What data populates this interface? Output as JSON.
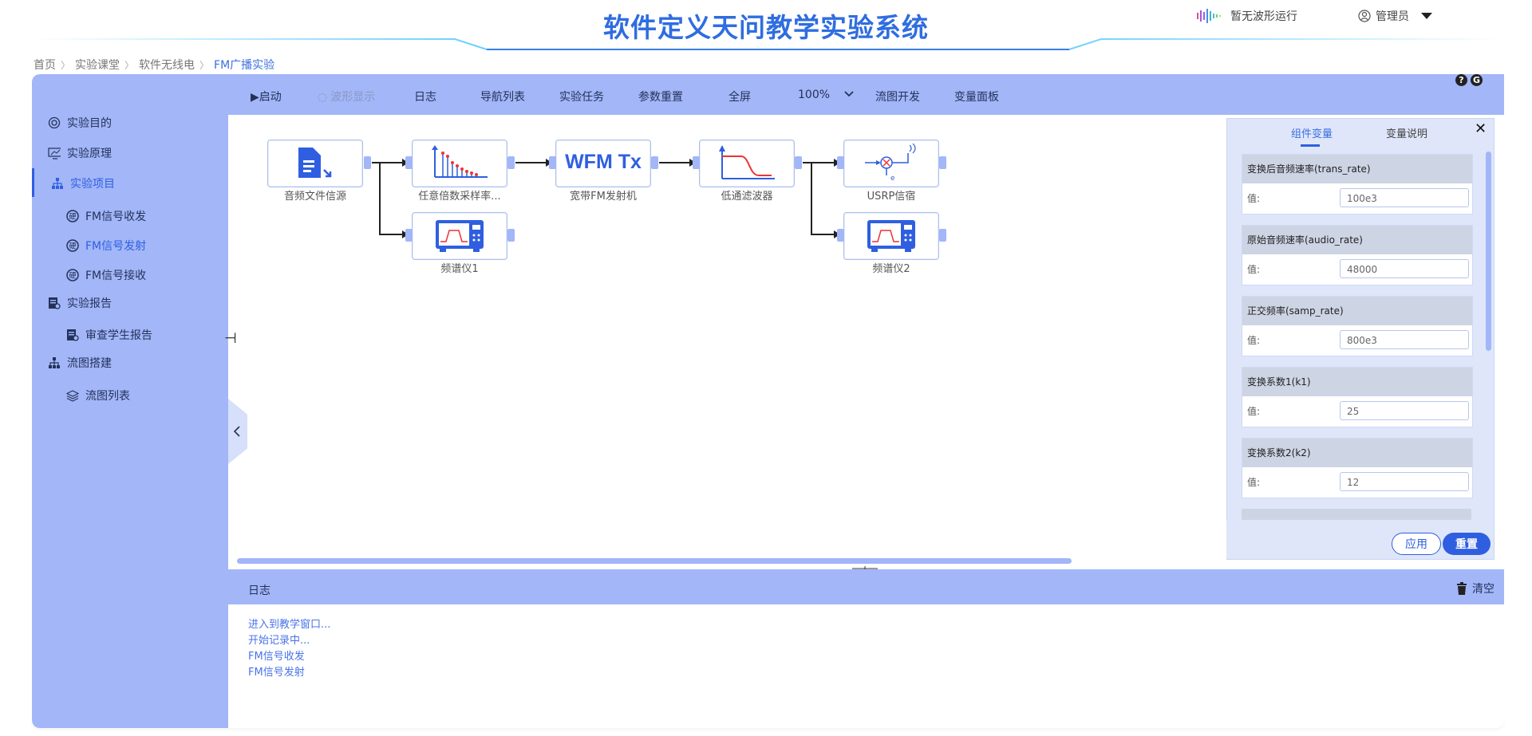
{
  "header": {
    "title": "软件定义天问教学实验系统",
    "wave_status": "暂无波形运行",
    "user": "管理员"
  },
  "breadcrumb": [
    "首页",
    "实验课堂",
    "软件无线电",
    "FM广播实验"
  ],
  "sidebar": {
    "items": [
      {
        "label": "实验目的"
      },
      {
        "label": "实验原理"
      },
      {
        "label": "实验项目"
      },
      {
        "label": "FM信号收发"
      },
      {
        "label": "FM信号发射"
      },
      {
        "label": "FM信号接收"
      },
      {
        "label": "实验报告"
      },
      {
        "label": "审查学生报告"
      },
      {
        "label": "流图搭建"
      },
      {
        "label": "流图列表"
      }
    ]
  },
  "toolbar": {
    "start": "▶启动",
    "waveform": "波形显示",
    "log": "日志",
    "nav_list": "导航列表",
    "task": "实验任务",
    "reset_params": "参数重置",
    "fullscreen": "全屏",
    "zoom": "100%",
    "flow_dev": "流图开发",
    "var_panel": "变量面板"
  },
  "blocks": [
    {
      "label": "音频文件信源",
      "icon_text": ""
    },
    {
      "label": "任意倍数采样率...",
      "icon_text": ""
    },
    {
      "label": "宽带FM发射机",
      "icon_text": "WFM Tx"
    },
    {
      "label": "低通滤波器",
      "icon_text": ""
    },
    {
      "label": "USRP信宿",
      "icon_text": ""
    },
    {
      "label": "频谱仪1",
      "icon_text": ""
    },
    {
      "label": "频谱仪2",
      "icon_text": ""
    }
  ],
  "panel": {
    "tab_component": "组件变量",
    "tab_desc": "变量说明",
    "value_label": "值:",
    "variables": [
      {
        "name": "变换后音频速率(trans_rate)",
        "value": "100e3"
      },
      {
        "name": "原始音频速率(audio_rate)",
        "value": "48000"
      },
      {
        "name": "正交频率(samp_rate)",
        "value": "800e3"
      },
      {
        "name": "变换系数1(k1)",
        "value": "25"
      },
      {
        "name": "变换系数2(k2)",
        "value": "12"
      }
    ],
    "apply": "应用",
    "reset": "重置"
  },
  "log": {
    "title": "日志",
    "clear": "清空",
    "lines": [
      "进入到教学窗口...",
      "开始记录中...",
      "FM信号收发",
      "FM信号发射"
    ]
  },
  "colors": {
    "accent": "#2f6de0",
    "panel_blue": "#a2b6f8",
    "link_blue": "#4a73e8"
  }
}
